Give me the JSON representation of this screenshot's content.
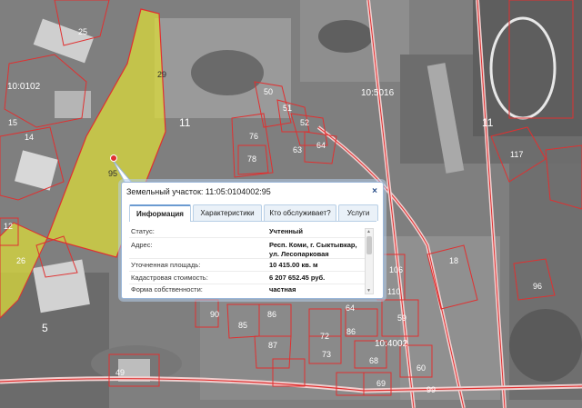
{
  "map": {
    "quarters": [
      "10:0102",
      "10:5016",
      "10:4002"
    ],
    "zones": [
      "11",
      "11",
      "5"
    ],
    "parcels": [
      "29",
      "25",
      "50",
      "51",
      "52",
      "64",
      "63",
      "76",
      "78",
      "117",
      "18",
      "96",
      "85",
      "86",
      "87",
      "72",
      "68",
      "73",
      "64",
      "49",
      "59",
      "60",
      "69",
      "110",
      "90",
      "95",
      "86",
      "106",
      "12",
      "15",
      "14",
      "26",
      "99"
    ]
  },
  "popup": {
    "title": "Земельный участок: 11:05:0104002:95",
    "close": "×",
    "tabs": [
      "Информация",
      "Характеристики",
      "Кто обслуживает?",
      "Услуги"
    ],
    "rows": [
      {
        "label": "Статус:",
        "value": "Учтенный"
      },
      {
        "label": "Адрес:",
        "value": "Респ. Коми, г. Сыктывкар, ул. Лесопарковая"
      },
      {
        "label": "Уточненная площадь:",
        "value": "10 415.00 кв. м"
      },
      {
        "label": "Кадастровая стоимость:",
        "value": "6 207 652.45 руб."
      },
      {
        "label": "Форма собственности:",
        "value": "частная"
      }
    ]
  },
  "colors": {
    "selected_parcel": "#d9d93a",
    "boundary": "#e03030",
    "road": "#f2dede",
    "popup_border": "#9bb7d9"
  }
}
